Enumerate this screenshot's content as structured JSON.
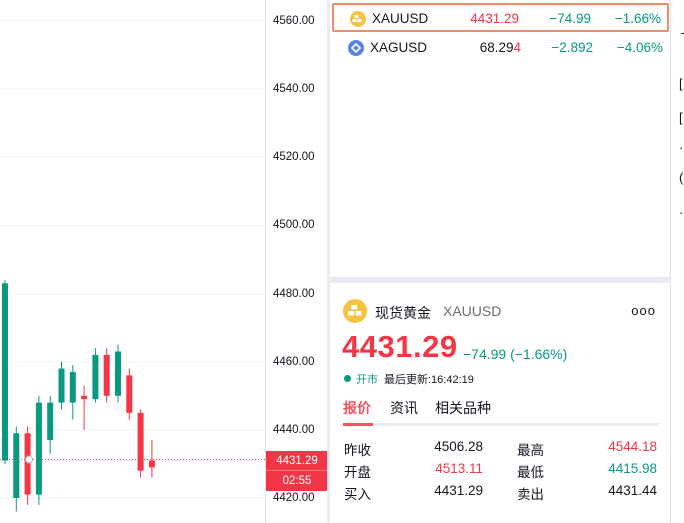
{
  "chart": {
    "price_axis_labels": [
      "4560.00",
      "4540.00",
      "4520.00",
      "4500.00",
      "4480.00",
      "4460.00",
      "4440.00",
      "4420.00"
    ],
    "current_price": "4431.29",
    "countdown": "02:55",
    "candle_colors": {
      "up": "#089981",
      "down": "#f23645"
    }
  },
  "chart_data": {
    "type": "candlestick",
    "ylim": [
      4416,
      4564
    ],
    "candles": [
      {
        "o": 4431,
        "h": 4484,
        "l": 4430,
        "c": 4483
      },
      {
        "o": 4420,
        "h": 4441,
        "l": 4416,
        "c": 4439
      },
      {
        "o": 4439,
        "h": 4441,
        "l": 4418,
        "c": 4421
      },
      {
        "o": 4421,
        "h": 4450,
        "l": 4418,
        "c": 4448
      },
      {
        "o": 4437,
        "h": 4450,
        "l": 4433,
        "c": 4448
      },
      {
        "o": 4448,
        "h": 4460,
        "l": 4446,
        "c": 4458
      },
      {
        "o": 4448,
        "h": 4459,
        "l": 4443,
        "c": 4457
      },
      {
        "o": 4450,
        "h": 4453,
        "l": 4440,
        "c": 4449
      },
      {
        "o": 4449,
        "h": 4464,
        "l": 4448,
        "c": 4462
      },
      {
        "o": 4462,
        "h": 4464,
        "l": 4448,
        "c": 4450
      },
      {
        "o": 4450,
        "h": 4465,
        "l": 4448,
        "c": 4463
      },
      {
        "o": 4456,
        "h": 4458,
        "l": 4443,
        "c": 4445
      },
      {
        "o": 4445,
        "h": 4446,
        "l": 4426,
        "c": 4428
      },
      {
        "o": 4431,
        "h": 4437,
        "l": 4426,
        "c": 4429
      }
    ]
  },
  "watchlist": {
    "rows": [
      {
        "symbol": "XAUUSD",
        "last_main": "4431.29",
        "last_tail": "",
        "change": "−74.99",
        "percent": "−1.66%",
        "icon": "gold-icon",
        "icon_color": "#f5c242"
      },
      {
        "symbol": "XAGUSD",
        "last_main": "68.29",
        "last_tail": "4",
        "change": "−2.892",
        "percent": "−4.06%",
        "icon": "silver-icon",
        "icon_color": "#5b86d6"
      }
    ]
  },
  "details": {
    "name": "现货黄金",
    "ticker": "XAUUSD",
    "more": "ooo",
    "price": "4431.29",
    "change": "−74.99 (−1.66%)",
    "market_status": "开市",
    "last_update": "最后更新:16:42:19",
    "tabs": [
      "报价",
      "资讯",
      "相关品种"
    ],
    "stats": [
      {
        "label": "昨收",
        "value": "4506.28",
        "label2": "最高",
        "value2": "4544.18"
      },
      {
        "label": "开盘",
        "value": "4513.11",
        "label2": "最低",
        "value2": "4415.98"
      },
      {
        "label": "买入",
        "value": "4431.29",
        "label2": "卖出",
        "value2": "4431.44"
      }
    ]
  },
  "edge_glyphs": [
    "ᄀ",
    "[",
    "[",
    "·",
    "(",
    "·"
  ],
  "colors": {
    "up": "#089981",
    "down": "#f23645",
    "accent": "#f7525f",
    "selected_border": "#f28b66"
  }
}
